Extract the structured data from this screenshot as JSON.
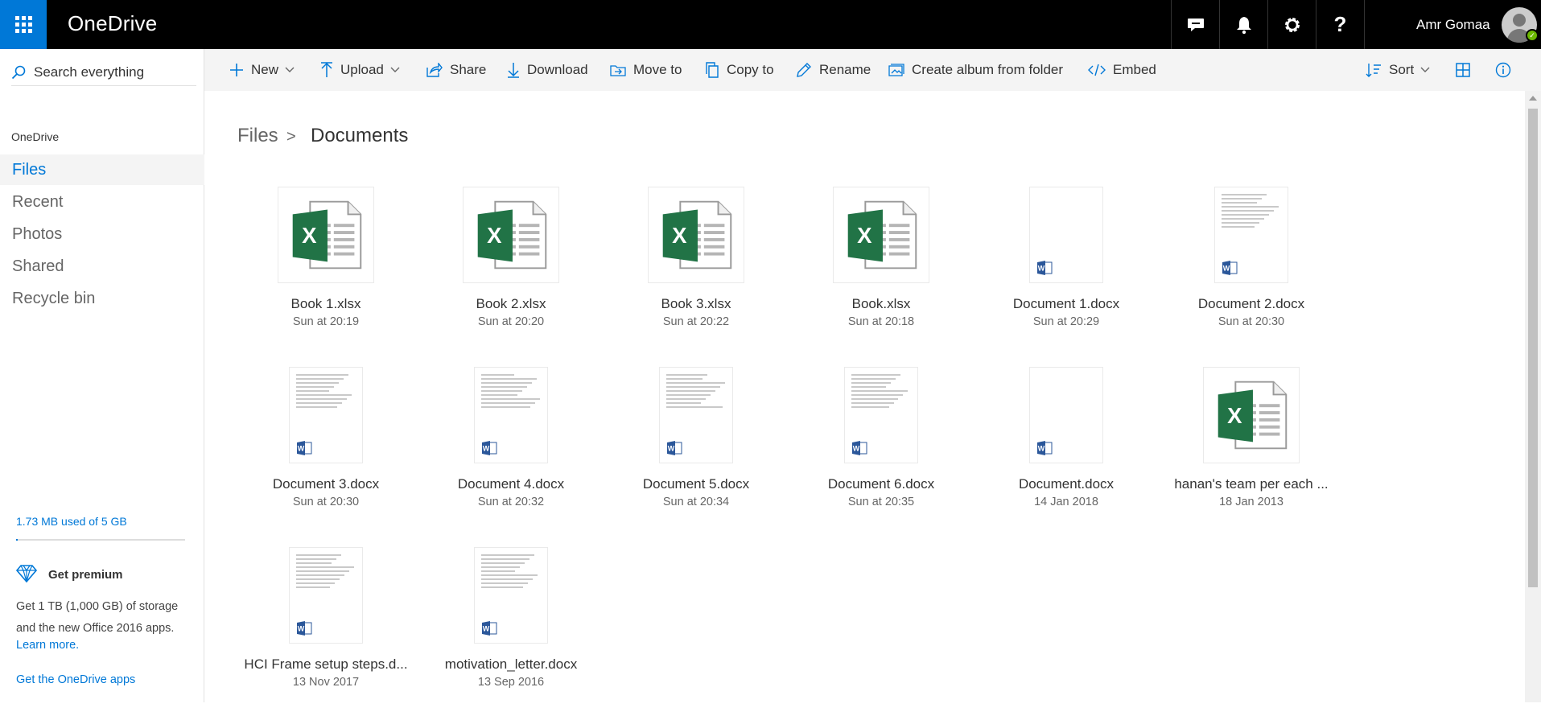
{
  "app": {
    "title": "OneDrive"
  },
  "topbar": {
    "icons": [
      "feedback-icon",
      "bell-icon",
      "gear-icon",
      "help-icon"
    ],
    "user_name": "Amr Gomaa"
  },
  "search": {
    "placeholder": "Search everything"
  },
  "sidebar": {
    "heading": "OneDrive",
    "items": [
      {
        "label": "Files",
        "active": true
      },
      {
        "label": "Recent",
        "active": false
      },
      {
        "label": "Photos",
        "active": false
      },
      {
        "label": "Shared",
        "active": false
      },
      {
        "label": "Recycle bin",
        "active": false
      }
    ],
    "storage_text": "1.73 MB used of 5 GB",
    "storage_fraction": 0.0003,
    "premium_title": "Get premium",
    "premium_text": "Get 1 TB (1,000 GB) of storage and the new Office 2016 apps.",
    "learn_more": "Learn more.",
    "get_apps": "Get the OneDrive apps"
  },
  "commands": {
    "new": "New",
    "upload": "Upload",
    "share": "Share",
    "download": "Download",
    "move_to": "Move to",
    "copy_to": "Copy to",
    "rename": "Rename",
    "create_album": "Create album from folder",
    "embed": "Embed",
    "sort": "Sort"
  },
  "breadcrumb": {
    "root": "Files",
    "separator": ">",
    "current": "Documents"
  },
  "files": [
    {
      "name": "Book 1.xlsx",
      "date": "Sun at 20:19",
      "kind": "excel"
    },
    {
      "name": "Book 2.xlsx",
      "date": "Sun at 20:20",
      "kind": "excel"
    },
    {
      "name": "Book 3.xlsx",
      "date": "Sun at 20:22",
      "kind": "excel"
    },
    {
      "name": "Book.xlsx",
      "date": "Sun at 20:18",
      "kind": "excel"
    },
    {
      "name": "Document 1.docx",
      "date": "Sun at 20:29",
      "kind": "word-blank"
    },
    {
      "name": "Document 2.docx",
      "date": "Sun at 20:30",
      "kind": "word"
    },
    {
      "name": "Document 3.docx",
      "date": "Sun at 20:30",
      "kind": "word"
    },
    {
      "name": "Document 4.docx",
      "date": "Sun at 20:32",
      "kind": "word"
    },
    {
      "name": "Document 5.docx",
      "date": "Sun at 20:34",
      "kind": "word"
    },
    {
      "name": "Document 6.docx",
      "date": "Sun at 20:35",
      "kind": "word"
    },
    {
      "name": "Document.docx",
      "date": "14 Jan 2018",
      "kind": "word-blank"
    },
    {
      "name": "hanan's team per each ...",
      "date": "18 Jan 2013",
      "kind": "excel"
    },
    {
      "name": "HCI Frame setup steps.d...",
      "date": "13 Nov 2017",
      "kind": "word"
    },
    {
      "name": "motivation_letter.docx",
      "date": "13 Sep 2016",
      "kind": "word"
    }
  ],
  "colors": {
    "accent": "#0078d7",
    "excel": "#217346",
    "word": "#2b579a",
    "topbar": "#000000"
  }
}
